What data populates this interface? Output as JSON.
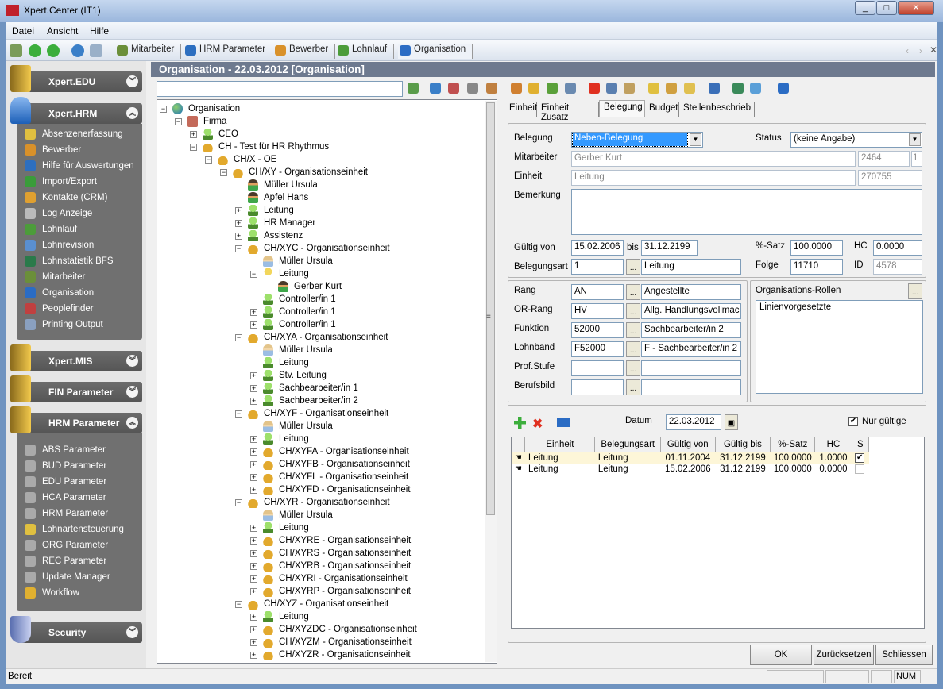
{
  "window": {
    "title": "Xpert.Center (IT1)",
    "controls": [
      "_",
      "□",
      "✕"
    ]
  },
  "menu": [
    "Datei",
    "Ansicht",
    "Hilfe"
  ],
  "toolbar": {
    "icons": [
      "exit-icon",
      "back-icon",
      "forward-icon",
      "web-icon",
      "print-icon"
    ],
    "tabs": [
      {
        "label": "Mitarbeiter",
        "color": "#6b8f3a"
      },
      {
        "label": "HRM Parameter",
        "color": "#2d6fc0"
      },
      {
        "label": "Bewerber",
        "color": "#d9912a"
      },
      {
        "label": "Lohnlauf",
        "color": "#4c9c3a"
      },
      {
        "label": "Organisation",
        "color": "#2b6cc4"
      }
    ]
  },
  "sidebar": {
    "edu": {
      "title": "Xpert.EDU"
    },
    "hrm": {
      "title": "Xpert.HRM",
      "items": [
        {
          "label": "Absenzenerfassung",
          "color": "#e0c040"
        },
        {
          "label": "Bewerber",
          "color": "#d9912a"
        },
        {
          "label": "Hilfe für Auswertungen",
          "color": "#2d6fc0"
        },
        {
          "label": "Import/Export",
          "color": "#3a9c3a"
        },
        {
          "label": "Kontakte (CRM)",
          "color": "#e0a030"
        },
        {
          "label": "Log Anzeige",
          "color": "#bbbbbb"
        },
        {
          "label": "Lohnlauf",
          "color": "#4c9c3a"
        },
        {
          "label": "Lohnrevision",
          "color": "#5a8fd0"
        },
        {
          "label": "Lohnstatistik BFS",
          "color": "#2a7a4a"
        },
        {
          "label": "Mitarbeiter",
          "color": "#6b8f3a"
        },
        {
          "label": "Organisation",
          "color": "#2b6cc4"
        },
        {
          "label": "Peoplefinder",
          "color": "#c04040"
        },
        {
          "label": "Printing Output",
          "color": "#8aa0c0"
        }
      ]
    },
    "mis": {
      "title": "Xpert.MIS"
    },
    "fin": {
      "title": "FIN Parameter"
    },
    "hrmparam": {
      "title": "HRM Parameter",
      "items": [
        {
          "label": "ABS Parameter",
          "color": "#aaaaaa"
        },
        {
          "label": "BUD Parameter",
          "color": "#aaaaaa"
        },
        {
          "label": "EDU Parameter",
          "color": "#aaaaaa"
        },
        {
          "label": "HCA Parameter",
          "color": "#aaaaaa"
        },
        {
          "label": "HRM Parameter",
          "color": "#aaaaaa"
        },
        {
          "label": "Lohnartensteuerung",
          "color": "#e0c040"
        },
        {
          "label": "ORG Parameter",
          "color": "#aaaaaa"
        },
        {
          "label": "REC Parameter",
          "color": "#aaaaaa"
        },
        {
          "label": "Update Manager",
          "color": "#aaaaaa"
        },
        {
          "label": "Workflow",
          "color": "#e0b030"
        }
      ]
    },
    "security": {
      "title": "Security"
    }
  },
  "main": {
    "header": "Organisation - 22.03.2012 [Organisation]",
    "search": {
      "value": ""
    }
  },
  "tree": [
    {
      "l": 0,
      "e": "-",
      "i": "globe",
      "t": "Organisation"
    },
    {
      "l": 1,
      "e": "-",
      "i": "fact",
      "t": "Firma"
    },
    {
      "l": 2,
      "e": "+",
      "i": "role",
      "t": "CEO"
    },
    {
      "l": 2,
      "e": "-",
      "i": "unit",
      "t": "CH - Test für HR Rhythmus"
    },
    {
      "l": 3,
      "e": "-",
      "i": "unit",
      "t": "CH/X - OE"
    },
    {
      "l": 4,
      "e": "-",
      "i": "unit",
      "t": "CH/XY - Organisationseinheit"
    },
    {
      "l": 5,
      "e": "",
      "i": "person",
      "t": "Müller Ursula"
    },
    {
      "l": 5,
      "e": "",
      "i": "person",
      "t": "Apfel Hans"
    },
    {
      "l": 5,
      "e": "+",
      "i": "role",
      "t": "Leitung"
    },
    {
      "l": 5,
      "e": "+",
      "i": "role",
      "t": "HR Manager"
    },
    {
      "l": 5,
      "e": "+",
      "i": "role",
      "t": "Assistenz"
    },
    {
      "l": 5,
      "e": "-",
      "i": "unit",
      "t": "CH/XYC - Organisationseinheit"
    },
    {
      "l": 6,
      "e": "",
      "i": "personl",
      "t": "Müller Ursula"
    },
    {
      "l": 6,
      "e": "-",
      "i": "roley",
      "t": "Leitung"
    },
    {
      "l": 7,
      "e": "",
      "i": "person",
      "t": "Gerber Kurt"
    },
    {
      "l": 6,
      "e": "",
      "i": "role",
      "t": "Controller/in 1"
    },
    {
      "l": 6,
      "e": "+",
      "i": "role",
      "t": "Controller/in 1"
    },
    {
      "l": 6,
      "e": "+",
      "i": "role",
      "t": "Controller/in 1"
    },
    {
      "l": 5,
      "e": "-",
      "i": "unit",
      "t": "CH/XYA - Organisationseinheit"
    },
    {
      "l": 6,
      "e": "",
      "i": "personl",
      "t": "Müller Ursula"
    },
    {
      "l": 6,
      "e": "",
      "i": "role",
      "t": "Leitung"
    },
    {
      "l": 6,
      "e": "+",
      "i": "role",
      "t": "Stv. Leitung"
    },
    {
      "l": 6,
      "e": "+",
      "i": "role",
      "t": "Sachbearbeiter/in 1"
    },
    {
      "l": 6,
      "e": "+",
      "i": "role",
      "t": "Sachbearbeiter/in 2"
    },
    {
      "l": 5,
      "e": "-",
      "i": "unit",
      "t": "CH/XYF - Organisationseinheit"
    },
    {
      "l": 6,
      "e": "",
      "i": "personl",
      "t": "Müller Ursula"
    },
    {
      "l": 6,
      "e": "+",
      "i": "role",
      "t": "Leitung"
    },
    {
      "l": 6,
      "e": "+",
      "i": "unit",
      "t": "CH/XYFA - Organisationseinheit"
    },
    {
      "l": 6,
      "e": "+",
      "i": "unit",
      "t": "CH/XYFB - Organisationseinheit"
    },
    {
      "l": 6,
      "e": "+",
      "i": "unit",
      "t": "CH/XYFL - Organisationseinheit"
    },
    {
      "l": 6,
      "e": "+",
      "i": "unit",
      "t": "CH/XYFD - Organisationseinheit"
    },
    {
      "l": 5,
      "e": "-",
      "i": "unit",
      "t": "CH/XYR - Organisationseinheit"
    },
    {
      "l": 6,
      "e": "",
      "i": "personl",
      "t": "Müller Ursula"
    },
    {
      "l": 6,
      "e": "+",
      "i": "role",
      "t": "Leitung"
    },
    {
      "l": 6,
      "e": "+",
      "i": "unit",
      "t": "CH/XYRE - Organisationseinheit"
    },
    {
      "l": 6,
      "e": "+",
      "i": "unit",
      "t": "CH/XYRS - Organisationseinheit"
    },
    {
      "l": 6,
      "e": "+",
      "i": "unit",
      "t": "CH/XYRB - Organisationseinheit"
    },
    {
      "l": 6,
      "e": "+",
      "i": "unit",
      "t": "CH/XYRI - Organisationseinheit"
    },
    {
      "l": 6,
      "e": "+",
      "i": "unit",
      "t": "CH/XYRP - Organisationseinheit"
    },
    {
      "l": 5,
      "e": "-",
      "i": "unit",
      "t": "CH/XYZ - Organisationseinheit"
    },
    {
      "l": 6,
      "e": "+",
      "i": "role",
      "t": "Leitung"
    },
    {
      "l": 6,
      "e": "+",
      "i": "unit",
      "t": "CH/XYZDC - Organisationseinheit"
    },
    {
      "l": 6,
      "e": "+",
      "i": "unit",
      "t": "CH/XYZM - Organisationseinheit"
    },
    {
      "l": 6,
      "e": "+",
      "i": "unit",
      "t": "CH/XYZR - Organisationseinheit"
    }
  ],
  "tabs": [
    {
      "label": "Einheit"
    },
    {
      "label": "Einheit Zusatz"
    },
    {
      "label": "Belegung",
      "active": true
    },
    {
      "label": "Budget"
    },
    {
      "label": "Stellenbeschrieb"
    }
  ],
  "form": {
    "belegung": {
      "label": "Belegung",
      "value": "Neben-Belegung"
    },
    "status": {
      "label": "Status",
      "value": "(keine Angabe)"
    },
    "mitarbeiter": {
      "label": "Mitarbeiter",
      "value": "Gerber Kurt",
      "nr": "2464",
      "seq": "1"
    },
    "einheit": {
      "label": "Einheit",
      "value": "Leitung",
      "nr": "270755"
    },
    "bemerkung": {
      "label": "Bemerkung",
      "value": ""
    },
    "gueltig": {
      "label": "Gültig von",
      "von": "15.02.2006",
      "bis_label": "bis",
      "bis": "31.12.2199"
    },
    "satz": {
      "label": "%-Satz",
      "value": "100.0000"
    },
    "hc": {
      "label": "HC",
      "value": "0.0000"
    },
    "belegungsart": {
      "label": "Belegungsart",
      "code": "1",
      "text": "Leitung"
    },
    "folge": {
      "label": "Folge",
      "value": "11710"
    },
    "id": {
      "label": "ID",
      "value": "4578"
    },
    "rows": [
      {
        "label": "Rang",
        "code": "AN",
        "text": "Angestellte"
      },
      {
        "label": "OR-Rang",
        "code": "HV",
        "text": "Allg. Handlungsvollmacht"
      },
      {
        "label": "Funktion",
        "code": "52000",
        "text": "Sachbearbeiter/in 2"
      },
      {
        "label": "Lohnband",
        "code": "F52000",
        "text": "F - Sachbearbeiter/in 2"
      },
      {
        "label": "Prof.Stufe",
        "code": "",
        "text": ""
      },
      {
        "label": "Berufsbild",
        "code": "",
        "text": ""
      }
    ],
    "rollen": {
      "label": "Organisations-Rollen",
      "items": [
        "Linienvorgesetzte"
      ]
    }
  },
  "history": {
    "datum_label": "Datum",
    "datum": "22.03.2012",
    "nur_gueltige": {
      "label": "Nur gültige",
      "checked": true
    },
    "columns": [
      "Einheit",
      "Belegungsart",
      "Gültig von",
      "Gültig bis",
      "%-Satz",
      "HC",
      "S"
    ],
    "rows": [
      {
        "einheit": "Leitung",
        "art": "Leitung",
        "von": "01.11.2004",
        "bis": "31.12.2199",
        "satz": "100.0000",
        "hc": "1.0000",
        "s": true
      },
      {
        "einheit": "Leitung",
        "art": "Leitung",
        "von": "15.02.2006",
        "bis": "31.12.2199",
        "satz": "100.0000",
        "hc": "0.0000",
        "s": false
      }
    ]
  },
  "buttons": {
    "ok": "OK",
    "reset": "Zurücksetzen",
    "close": "Schliessen"
  },
  "statusbar": {
    "text": "Bereit",
    "num": "NUM"
  }
}
